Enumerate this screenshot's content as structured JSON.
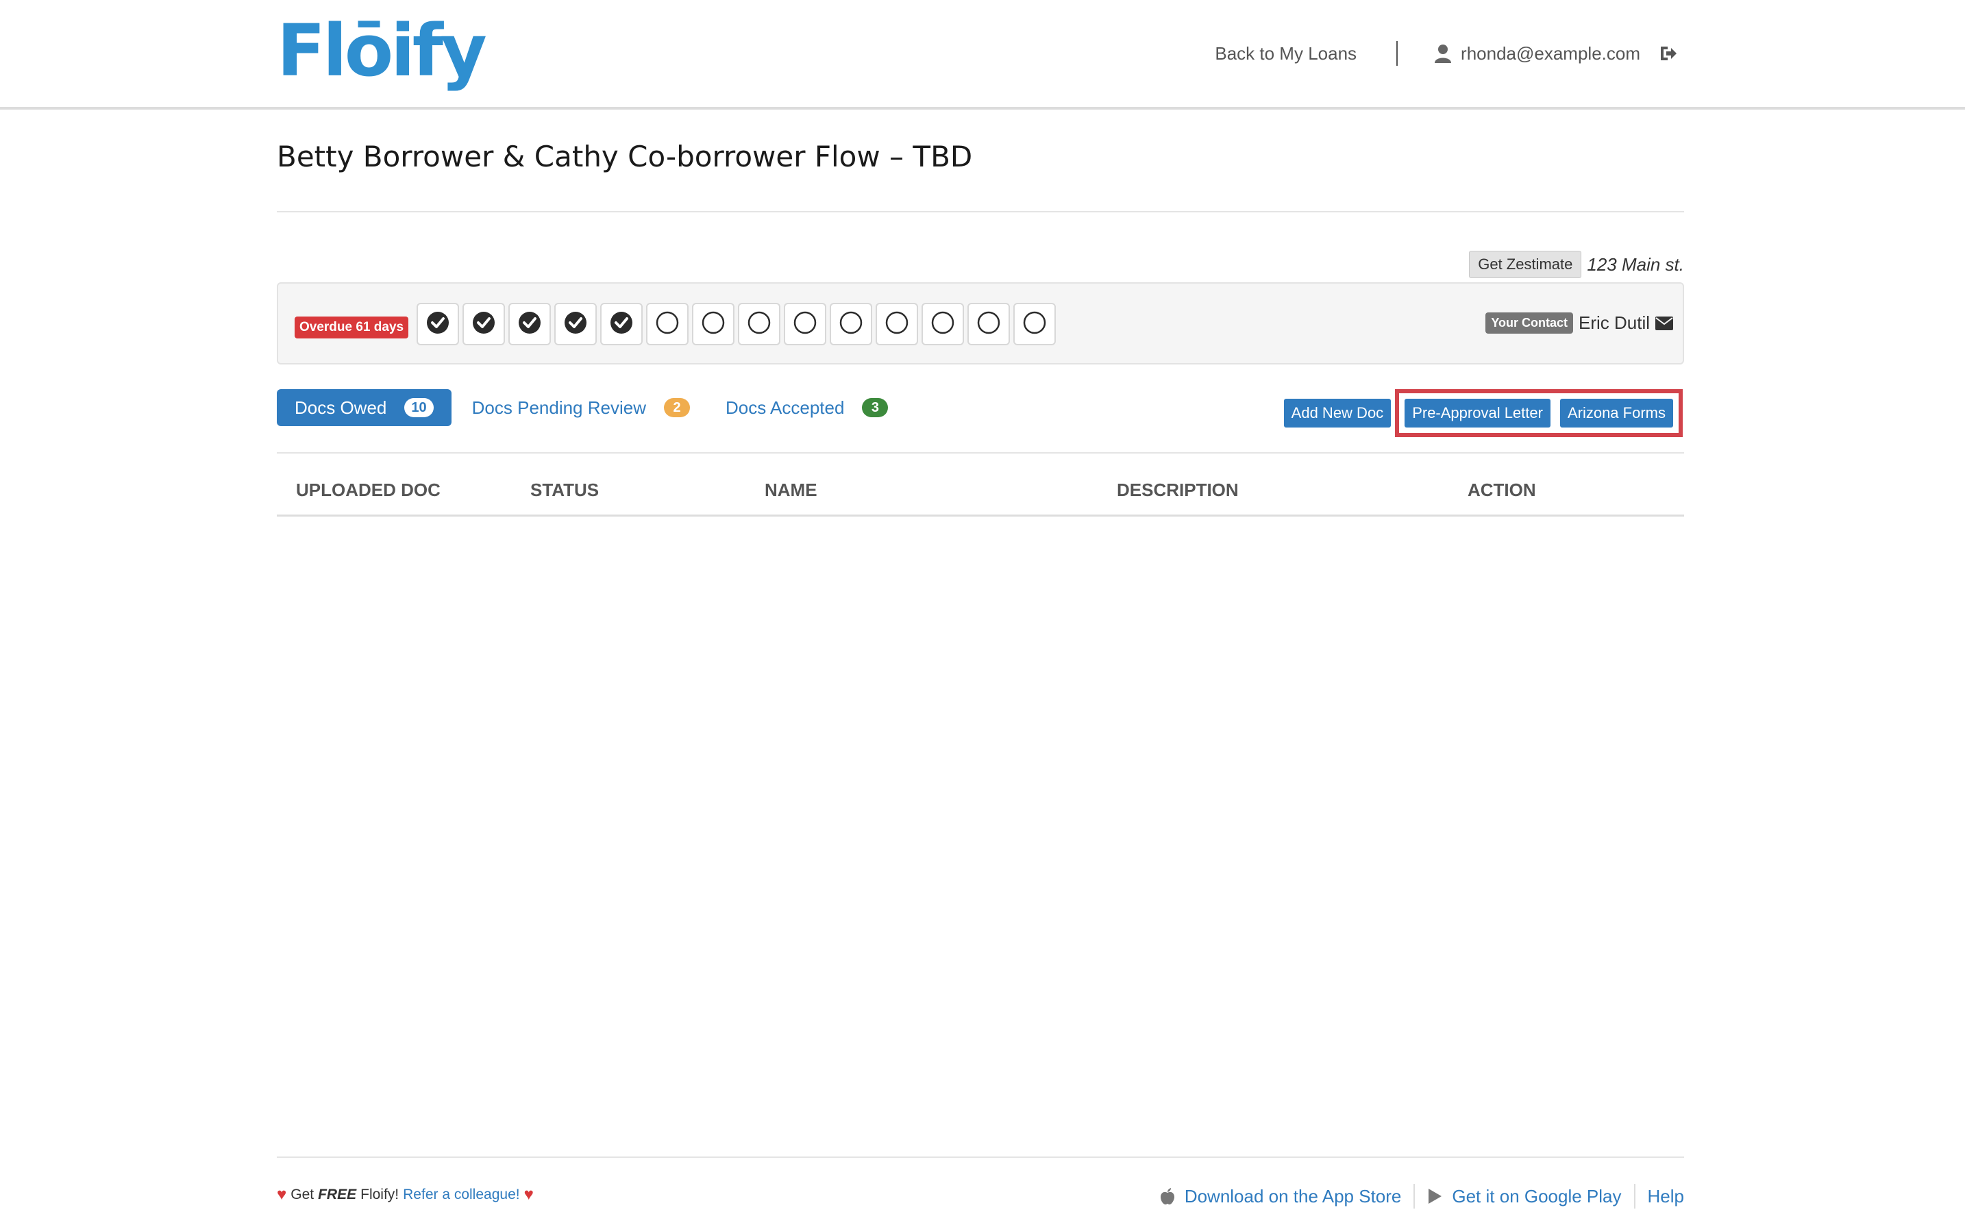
{
  "header": {
    "logo_text": "Flōify",
    "back_link": "Back to My Loans",
    "user_email": "rhonda@example.com"
  },
  "page": {
    "title": "Betty Borrower & Cathy Co-borrower Flow – TBD",
    "zestimate_label": "Get Zestimate",
    "address": "123 Main st."
  },
  "progress": {
    "overdue_label": "Overdue 61 days",
    "steps_completed": 5,
    "steps_total": 14,
    "contact_label": "Your Contact",
    "contact_name": "Eric Dutil"
  },
  "tabs": [
    {
      "label": "Docs Owed",
      "count": "10",
      "active": true
    },
    {
      "label": "Docs Pending Review",
      "count": "2",
      "active": false
    },
    {
      "label": "Docs Accepted",
      "count": "3",
      "active": false
    }
  ],
  "actions": {
    "add_new_doc": "Add New Doc",
    "pre_approval": "Pre-Approval Letter",
    "arizona_forms": "Arizona Forms"
  },
  "table": {
    "columns": [
      "UPLOADED DOC",
      "STATUS",
      "NAME",
      "DESCRIPTION",
      "ACTION"
    ]
  },
  "footer": {
    "get": "Get",
    "free": "FREE",
    "floify": "Floify!",
    "refer": "Refer a colleague!",
    "app_store": "Download on the App Store",
    "google_play": "Get it on Google Play",
    "help": "Help"
  },
  "colors": {
    "brand": "#2f8fd0",
    "primary": "#2f7bbf",
    "danger": "#d9383a",
    "highlight": "#d2434b"
  },
  "icons": [
    "user-icon",
    "logout-icon",
    "check-circle-icon",
    "empty-circle-icon",
    "envelope-icon",
    "heart-icon",
    "apple-icon",
    "play-icon"
  ]
}
